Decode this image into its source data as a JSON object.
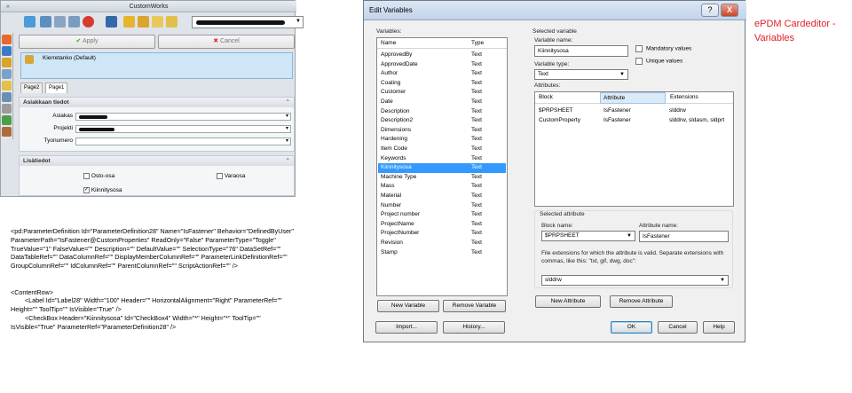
{
  "custom_works": {
    "title": "CustomWorks",
    "apply_label": "Apply",
    "cancel_label": "Cancel",
    "description": "Kierretanko (Default)",
    "tabs": [
      "Page2",
      "Page1"
    ],
    "group1_title": "Asiakkaan tiedot",
    "fields": [
      {
        "label": "Asiakas"
      },
      {
        "label": "Projekti"
      },
      {
        "label": "Tyonumero"
      }
    ],
    "group2_title": "Lisätiedot",
    "checkboxes": [
      {
        "label": "Osto-osa",
        "checked": false
      },
      {
        "label": "Varaosa",
        "checked": false
      },
      {
        "label": "Kiinnitysosa",
        "checked": true
      }
    ]
  },
  "code_text": "<pd:ParameterDefinition Id=\"ParameterDefinition28\" Name=\"IsFastener\" Behavior=\"DefinedByUser\"\nParameterPath=\"IsFastener@CustomProperties\" ReadOnly=\"False\" ParameterType=\"Toggle\"\nTrueValue=\"1\" FalseValue=\"\" Description=\"\" DefaultValue=\"\" SelectionType=\"76\" DataSetRef=\"\"\nDataTableRef=\"\" DataColumnRef=\"\" DisplayMemberColumnRef=\"\" ParameterLinkDefinitionRef=\"\"\nGroupColumnRef=\"\" IdColumnRef=\"\" ParentColumnRef=\"\" ScriptActionRef=\"\" />\n\n\n<ContentRow>\n        <Label Id=\"Label28\" Width=\"100\" Header=\"\" HorizontalAlignment=\"Right\" ParameterRef=\"\"\nHeight=\"\" ToolTip=\"\" IsVisible=\"True\" />\n        <CheckBox Header=\"Kiinnitysosa\" Id=\"CheckBox4\" Width=\"*\" Height=\"*\" ToolTip=\"\"\nIsVisible=\"True\" ParameterRef=\"ParameterDefinition28\" />",
  "dialog": {
    "title": "Edit Variables",
    "help_glyph": "?",
    "close_glyph": "X",
    "variables_label": "Variables:",
    "col_name": "Name",
    "col_type": "Type",
    "variables": [
      {
        "name": "ApprovedBy",
        "type": "Text"
      },
      {
        "name": "ApprovedDate",
        "type": "Text"
      },
      {
        "name": "Author",
        "type": "Text"
      },
      {
        "name": "Coating",
        "type": "Text"
      },
      {
        "name": "Customer",
        "type": "Text"
      },
      {
        "name": "Date",
        "type": "Text"
      },
      {
        "name": "Description",
        "type": "Text"
      },
      {
        "name": "Description2",
        "type": "Text"
      },
      {
        "name": "Dimensions",
        "type": "Text"
      },
      {
        "name": "Hardening",
        "type": "Text"
      },
      {
        "name": "Item Code",
        "type": "Text"
      },
      {
        "name": "Keywords",
        "type": "Text"
      },
      {
        "name": "Kiinnitysosa",
        "type": "Text",
        "selected": true
      },
      {
        "name": "Machine Type",
        "type": "Text"
      },
      {
        "name": "Mass",
        "type": "Text"
      },
      {
        "name": "Material",
        "type": "Text"
      },
      {
        "name": "Number",
        "type": "Text"
      },
      {
        "name": "Project number",
        "type": "Text"
      },
      {
        "name": "ProjectName",
        "type": "Text"
      },
      {
        "name": "ProjectNumber",
        "type": "Text"
      },
      {
        "name": "Revision",
        "type": "Text"
      },
      {
        "name": "Stamp",
        "type": "Text"
      }
    ],
    "new_variable": "New Variable",
    "remove_variable": "Remove Variable",
    "import": "Import...",
    "history": "History...",
    "selected_variable": "Selected variable",
    "variable_name_label": "Variable name:",
    "variable_name": "Kiinnitysosa",
    "mandatory": "Mandatory values",
    "unique": "Unique values",
    "variable_type_label": "Variable type:",
    "variable_type": "Text",
    "attributes_label": "Attributes:",
    "col_block": "Block",
    "col_attribute": "Attribute",
    "col_extensions": "Extensions",
    "attributes": [
      {
        "block": "$PRPSHEET",
        "attribute": "IsFastener",
        "ext": "slddrw"
      },
      {
        "block": "CustomProperty",
        "attribute": "IsFastener",
        "ext": "slddrw, sldasm, sldprt"
      }
    ],
    "selected_attribute": "Selected attribute",
    "block_name_label": "Block name:",
    "block_name": "$PRPSHEET",
    "attribute_name_label": "Attribute name:",
    "attribute_name": "IsFastener",
    "ext_help": "File extensions for which the attribute is valid. Separate extensions with commas, like this: \"txt, gif, dwg, doc\":",
    "extensions": "slddrw",
    "new_attribute": "New Attribute",
    "remove_attribute": "Remove Attribute",
    "ok": "OK",
    "cancel": "Cancel",
    "help": "Help"
  },
  "note": "ePDM Cardeditor - Variables",
  "colors": {
    "accent_red": "#e0202a",
    "selection": "#3399ff"
  }
}
